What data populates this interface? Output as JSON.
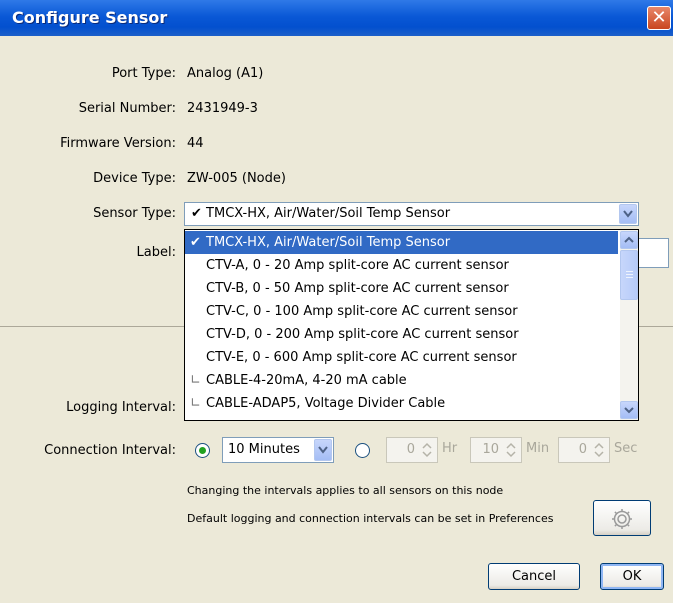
{
  "window": {
    "title": "Configure Sensor",
    "close_label": "✕"
  },
  "fields": {
    "port_type_label": "Port Type:",
    "port_type_value": "Analog (A1)",
    "serial_number_label": "Serial Number:",
    "serial_number_value": "2431949-3",
    "firmware_version_label": "Firmware Version:",
    "firmware_version_value": "44",
    "device_type_label": "Device Type:",
    "device_type_value": "ZW-005 (Node)",
    "sensor_type_label": "Sensor Type:",
    "sensor_type_value": "TMCX-HX, Air/Water/Soil Temp Sensor",
    "label_label": "Label:"
  },
  "dropdown": {
    "items": [
      {
        "mark": "✔",
        "text": "TMCX-HX, Air/Water/Soil Temp Sensor",
        "selected": true
      },
      {
        "mark": "",
        "text": "CTV-A, 0 - 20 Amp split-core AC current sensor",
        "selected": false
      },
      {
        "mark": "",
        "text": "CTV-B, 0 - 50 Amp split-core AC current sensor",
        "selected": false
      },
      {
        "mark": "",
        "text": "CTV-C, 0 - 100 Amp split-core AC current sensor",
        "selected": false
      },
      {
        "mark": "",
        "text": "CTV-D, 0 - 200 Amp split-core AC current sensor",
        "selected": false
      },
      {
        "mark": "",
        "text": "CTV-E, 0 - 600 Amp split-core AC current sensor",
        "selected": false
      },
      {
        "mark": "∟",
        "text": "CABLE-4-20mA, 4-20 mA cable",
        "selected": false
      },
      {
        "mark": "∟",
        "text": "CABLE-ADAP5, Voltage Divider Cable",
        "selected": false
      }
    ]
  },
  "intervals": {
    "logging_label": "Logging Interval:",
    "connection_label": "Connection Interval:",
    "preset_value": "10 Minutes",
    "hr_value": "0",
    "hr_unit": "Hr",
    "min_value": "10",
    "min_unit": "Min",
    "sec_value": "0",
    "sec_unit": "Sec",
    "note1": "Changing the intervals applies to all sensors on this node",
    "note2": "Default logging and connection intervals can be set in Preferences"
  },
  "buttons": {
    "cancel": "Cancel",
    "ok": "OK"
  },
  "icons": {
    "close": "close-icon",
    "gear": "gear-icon",
    "combo_arrow": "chevron-down-icon"
  },
  "colors": {
    "titlebar": "#0a58d6",
    "selection": "#316ac5",
    "background": "#ece9d8"
  }
}
